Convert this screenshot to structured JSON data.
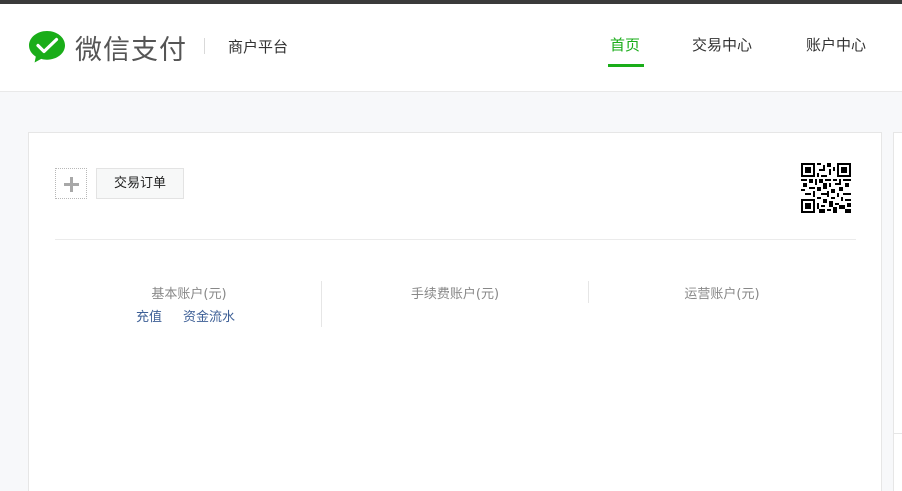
{
  "header": {
    "brand": "微信支付",
    "platform": "商户平台",
    "nav": [
      {
        "label": "首页",
        "active": true
      },
      {
        "label": "交易中心",
        "active": false
      },
      {
        "label": "账户中心",
        "active": false
      }
    ]
  },
  "toolbar": {
    "add_icon": "plus-icon",
    "shortcut_label": "交易订单"
  },
  "accounts": [
    {
      "label": "基本账户(元)",
      "links": [
        "充值",
        "资金流水"
      ]
    },
    {
      "label": "手续费账户(元)"
    },
    {
      "label": "运营账户(元)"
    }
  ],
  "colors": {
    "accent": "#1aad19",
    "link": "#3d5f96"
  }
}
